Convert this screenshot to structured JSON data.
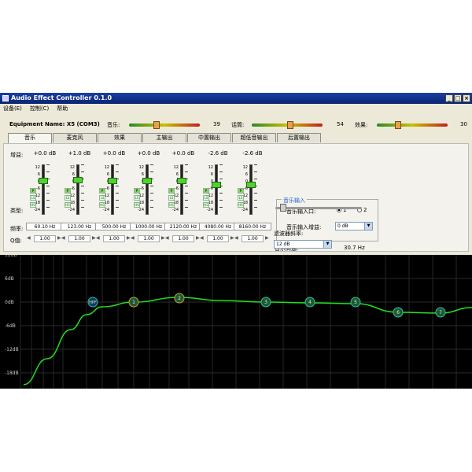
{
  "window": {
    "title": "Audio Effect Controller 0.1.0",
    "buttons": [
      "_",
      "□",
      "×"
    ]
  },
  "menu": [
    "设备(E)",
    "控制(C)",
    "帮助"
  ],
  "device": {
    "label": "Equipment Name: X5 (COM3)",
    "sliders": [
      {
        "label": "音乐:",
        "value": "39",
        "level": 0.39
      },
      {
        "label": "话筒:",
        "value": "54",
        "level": 0.54
      },
      {
        "label": "效果:",
        "value": "30",
        "level": 0.3
      }
    ]
  },
  "tabs": [
    "音乐",
    "麦克风",
    "效果",
    "主输出",
    "中置输出",
    "超低音输出",
    "后置输出"
  ],
  "active_tab": "音乐",
  "row_labels": {
    "gain": "增益:",
    "type": "类型:",
    "freq": "频率:",
    "q": "Q值:"
  },
  "fader_ticks": [
    "12",
    "6",
    "0",
    "-6",
    "-12",
    "-18",
    "-24"
  ],
  "type_icons": [
    "P",
    "LS",
    "HS"
  ],
  "bands": [
    {
      "gain": "+0.0 dB",
      "freq": "60.10 Hz",
      "q": "1.00",
      "level": 0
    },
    {
      "gain": "+1.0 dB",
      "freq": "123.00 Hz",
      "q": "1.00",
      "level": 1
    },
    {
      "gain": "+0.0 dB",
      "freq": "500.00 Hz",
      "q": "1.00",
      "level": 0
    },
    {
      "gain": "+0.0 dB",
      "freq": "1000.00 Hz",
      "q": "1.00",
      "level": 0
    },
    {
      "gain": "+0.0 dB",
      "freq": "2120.00 Hz",
      "q": "1.00",
      "level": 0
    },
    {
      "gain": "-2.6 dB",
      "freq": "4080.00 Hz",
      "q": "1.00",
      "level": -2.6
    },
    {
      "gain": "-2.6 dB",
      "freq": "8160.00 Hz",
      "q": "1.00",
      "level": -2.6
    }
  ],
  "music_input": {
    "title": "音乐输入",
    "port_label": "音乐输入口:",
    "port_options": [
      "1",
      "2"
    ],
    "port_selected": "1",
    "gain_label": "音乐输入增益:",
    "gain_value": "0 dB"
  },
  "highpass": {
    "label": "音乐高通:",
    "value": "30.7 Hz",
    "level": 0.05
  },
  "filter_slope": {
    "label": "滤波器斜率:",
    "value": "12 dB"
  },
  "graph": {
    "y_labels": [
      "12dB",
      "6dB",
      "0dB",
      "-6dB",
      "-12dB",
      "-18dB"
    ],
    "node_labels": [
      "HPF",
      "1",
      "2",
      "3",
      "4",
      "5",
      "6",
      "7"
    ]
  },
  "colors": {
    "curve": "#22e01e",
    "fader_knob": "#53d031",
    "title_bar": "#0a2470"
  }
}
